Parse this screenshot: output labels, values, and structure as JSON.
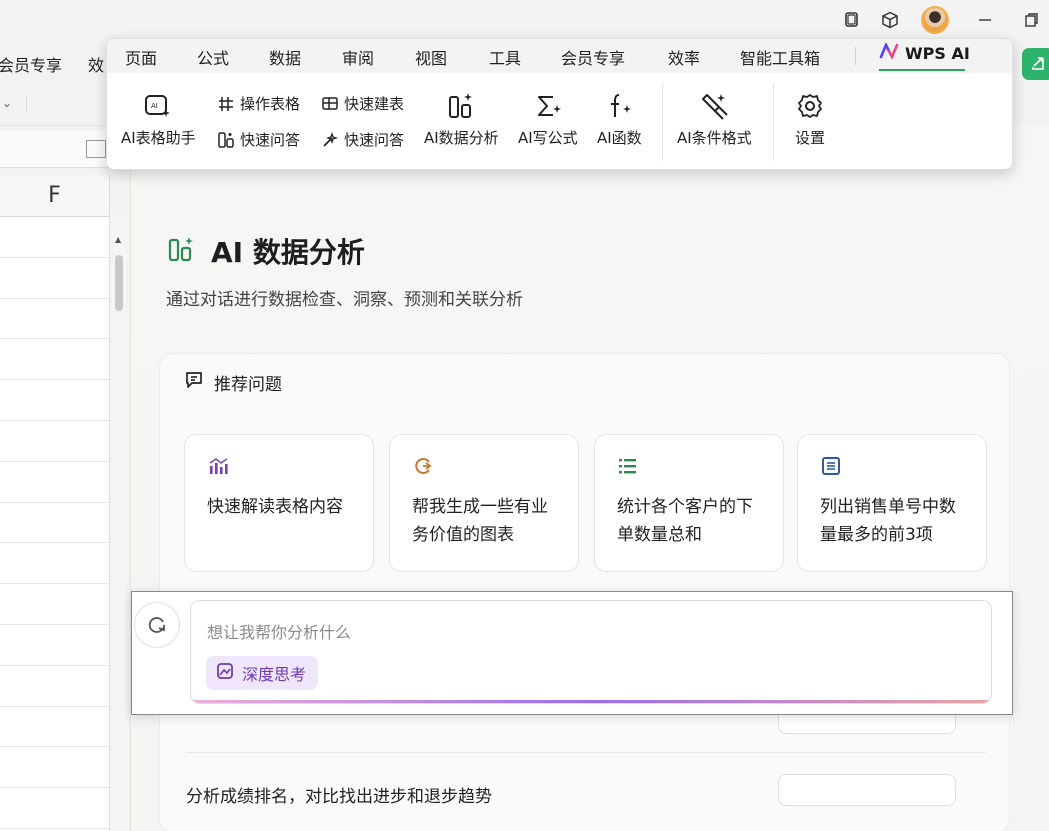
{
  "window": {
    "bg_menu": [
      "会员专享",
      "效"
    ]
  },
  "sheet": {
    "column_label": "F"
  },
  "ribbon": {
    "tabs": [
      "页面",
      "公式",
      "数据",
      "审阅",
      "视图",
      "工具",
      "会员专享",
      "效率",
      "智能工具箱"
    ],
    "active_tab": "WPS AI",
    "tools": {
      "table_assistant": "AI表格助手",
      "operate_table": "操作表格",
      "quick_build": "快速建表",
      "quick_qa_1": "快速问答",
      "quick_qa_2": "快速问答",
      "data_analysis": "AI数据分析",
      "write_formula": "AI写公式",
      "functions": "AI函数",
      "conditional_format": "AI条件格式",
      "settings": "设置"
    }
  },
  "panel": {
    "title": "AI 数据分析",
    "subtitle": "通过对话进行数据检查、洞察、预测和关联分析",
    "recommend_label": "推荐问题",
    "questions": [
      {
        "icon": "bar-chart-icon",
        "color": "#7b3fb8",
        "text": "快速解读表格内容"
      },
      {
        "icon": "chart-refresh-icon",
        "color": "#c07a35",
        "text": "帮我生成一些有业务价值的图表"
      },
      {
        "icon": "list-icon",
        "color": "#2f8a4a",
        "text": "统计各个客户的下单数量总和"
      },
      {
        "icon": "document-list-icon",
        "color": "#2b5aa6",
        "text": "列出销售单号中数量最多的前3项"
      }
    ],
    "list_items": [
      "分析成绩排名，对比找出进步和退步趋势"
    ]
  },
  "input": {
    "placeholder": "想让我帮你分析什么",
    "deep_think_label": "深度思考"
  },
  "colors": {
    "accent_green": "#2aa65a",
    "purple": "#6e3bb5"
  }
}
